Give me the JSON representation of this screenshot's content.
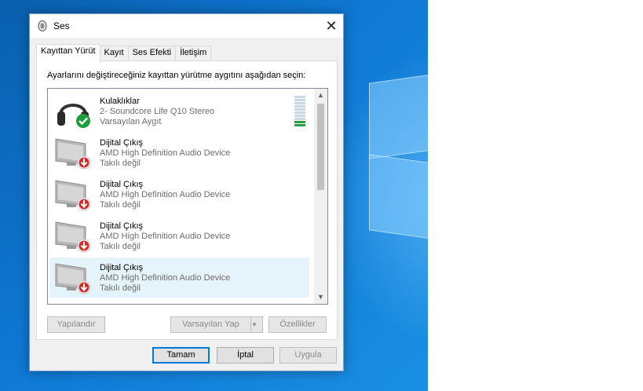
{
  "window": {
    "title": "Ses",
    "close_glyph": "✕"
  },
  "tabs": [
    {
      "label": "Kayıttan Yürüt",
      "active": true
    },
    {
      "label": "Kayıt",
      "active": false
    },
    {
      "label": "Ses Efekti",
      "active": false
    },
    {
      "label": "İletişim",
      "active": false
    }
  ],
  "instruction": "Ayarlarını değiştireceğiniz kayıttan yürütme aygıtını aşağıdan seçin:",
  "devices": [
    {
      "name": "Kulaklıklar",
      "description": "2- Soundcore Life Q10 Stereo",
      "status": "Varsayılan Aygıt",
      "icon": "headphones-icon",
      "badge": "default-check-badge",
      "selected": false
    },
    {
      "name": "Dijital Çıkış",
      "description": "AMD High Definition Audio Device",
      "status": "Takılı değil",
      "icon": "monitor-icon",
      "badge": "unplugged-arrow-badge",
      "selected": false
    },
    {
      "name": "Dijital Çıkış",
      "description": "AMD High Definition Audio Device",
      "status": "Takılı değil",
      "icon": "monitor-icon",
      "badge": "unplugged-arrow-badge",
      "selected": false
    },
    {
      "name": "Dijital Çıkış",
      "description": "AMD High Definition Audio Device",
      "status": "Takılı değil",
      "icon": "monitor-icon",
      "badge": "unplugged-arrow-badge",
      "selected": false
    },
    {
      "name": "Dijital Çıkış",
      "description": "AMD High Definition Audio Device",
      "status": "Takılı değil",
      "icon": "monitor-icon",
      "badge": "unplugged-arrow-badge",
      "selected": true
    }
  ],
  "level_meter": {
    "segments": 10,
    "active_segments": 2
  },
  "buttons": {
    "configure": "Yapılandır",
    "set_default": "Varsayılan Yap",
    "properties": "Özellikler",
    "ok": "Tamam",
    "cancel": "İptal",
    "apply": "Uygula"
  },
  "colors": {
    "accent": "#0078d7",
    "check_green": "#1e9e3a",
    "unplugged_red": "#d42a2a",
    "selection": "#e5f3fb"
  }
}
